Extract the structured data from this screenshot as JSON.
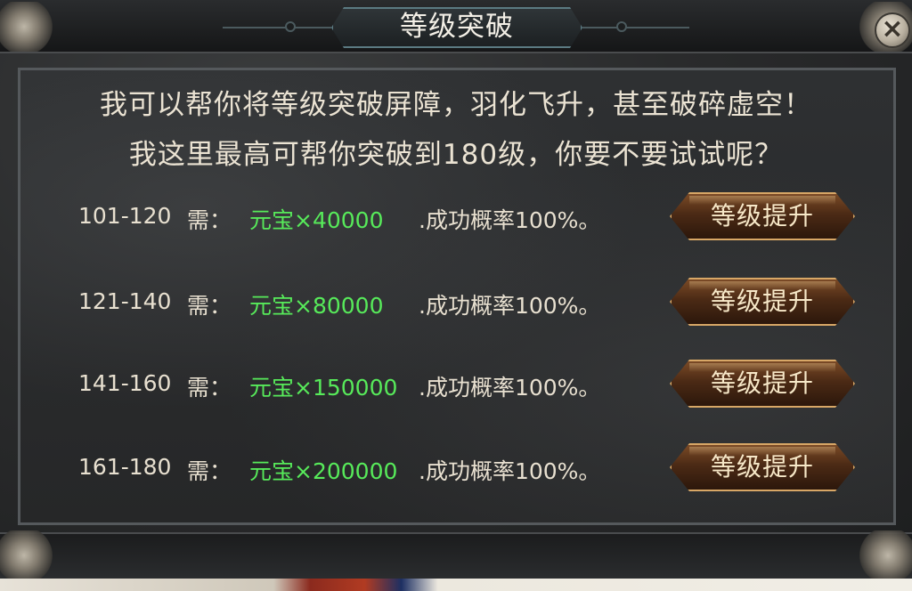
{
  "window": {
    "title": "等级突破",
    "close_label": "×"
  },
  "intro": {
    "line1": "我可以帮你将等级突破屏障，羽化飞升，甚至破碎虚空！",
    "line2": "我这里最高可帮你突破到180级，你要不要试试呢？"
  },
  "rows": [
    {
      "range": "101-120",
      "need": "需：",
      "cost": "元宝×40000",
      "rate": ".成功概率100%。",
      "button": "等级提升"
    },
    {
      "range": "121-140",
      "need": "需：",
      "cost": "元宝×80000",
      "rate": ".成功概率100%。",
      "button": "等级提升"
    },
    {
      "range": "141-160",
      "need": "需：",
      "cost": "元宝×150000",
      "rate": ".成功概率100%。",
      "button": "等级提升"
    },
    {
      "range": "161-180",
      "need": "需：",
      "cost": "元宝×200000",
      "rate": ".成功概率100%。",
      "button": "等级提升"
    }
  ],
  "colors": {
    "cost_green": "#57ea5a",
    "text_cream": "#e8e0d0",
    "button_gold": "#d8a766"
  }
}
